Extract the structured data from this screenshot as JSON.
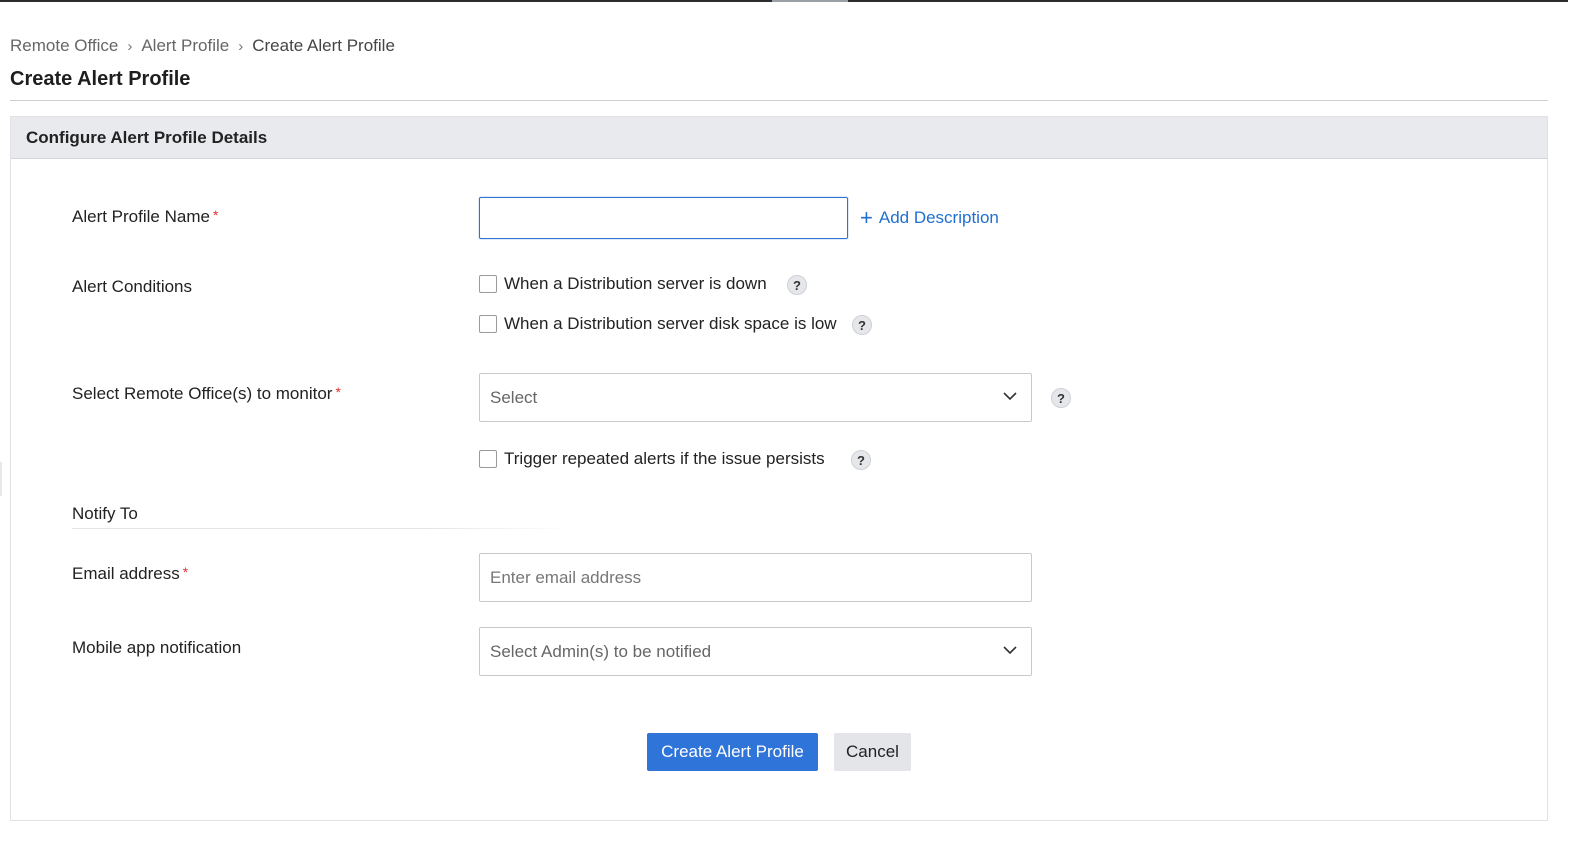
{
  "breadcrumb": {
    "items": [
      "Remote Office",
      "Alert Profile",
      "Create Alert Profile"
    ]
  },
  "page": {
    "title": "Create Alert Profile"
  },
  "panel": {
    "header": "Configure Alert Profile Details"
  },
  "form": {
    "alert_profile_name": {
      "label": "Alert Profile Name",
      "value": "",
      "placeholder": "",
      "add_description": "Add Description"
    },
    "alert_conditions": {
      "label": "Alert Conditions",
      "options": [
        {
          "label": "When a Distribution server is down",
          "checked": false
        },
        {
          "label": "When a Distribution server disk space is low",
          "checked": false
        }
      ]
    },
    "remote_offices": {
      "label": "Select Remote Office(s) to monitor",
      "selected": "Select"
    },
    "repeat_alerts": {
      "label": "Trigger repeated alerts if the issue persists",
      "checked": false
    },
    "notify_to": {
      "heading": "Notify To"
    },
    "email": {
      "label": "Email address",
      "placeholder": "Enter email address",
      "value": ""
    },
    "mobile_notification": {
      "label": "Mobile app notification",
      "selected": "Select Admin(s) to be notified"
    },
    "required_marker": "*",
    "help_glyph": "?"
  },
  "actions": {
    "create_label": "Create Alert Profile",
    "cancel_label": "Cancel"
  },
  "colors": {
    "accent": "#2f74d8",
    "link": "#1f6fd0",
    "required": "#e03131",
    "header_bg": "#e9eaed"
  },
  "icons": {
    "breadcrumb_separator": "chevron-right-icon",
    "add": "plus-icon",
    "dropdown": "chevron-down-icon",
    "help": "question-icon"
  }
}
